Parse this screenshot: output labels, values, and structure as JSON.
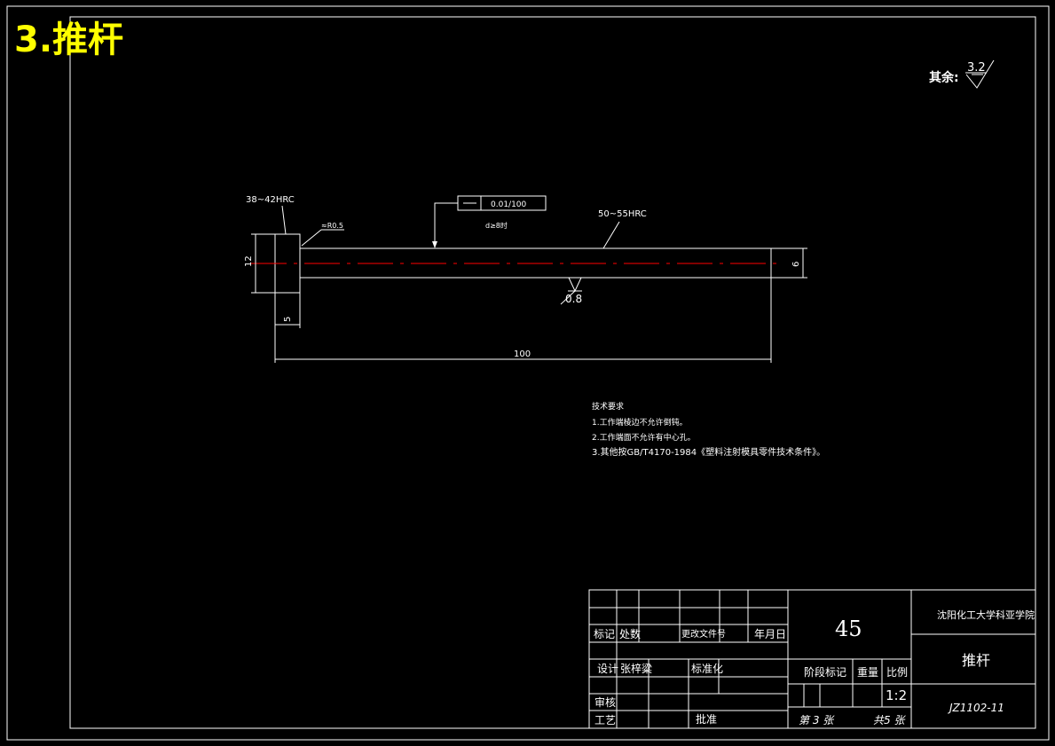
{
  "heading": "3.推杆",
  "roughness_other": {
    "label": "其余:",
    "value": "3.2"
  },
  "hardness_head": "38~42HRC",
  "hardness_rod": "50~55HRC",
  "chamfer": "≈R0.5",
  "tolerance_frame": {
    "value": "0.01/100",
    "note": "d≥8时"
  },
  "surface_finish_rod": "0.8",
  "dimensions": {
    "head_height": "12",
    "head_width": "5",
    "rod_diameter": "6",
    "length": "100"
  },
  "tech_requirements": {
    "title": "技术要求",
    "items": [
      "1.工作端棱边不允许倒钝。",
      "2.工作端面不允许有中心孔。",
      "3.其他按GB/T4170-1984《塑料注射模具零件技术条件》。"
    ]
  },
  "title_block": {
    "header_labels": {
      "mark": "标记",
      "count": "处数",
      "doc_no": "更改文件号",
      "date": "年月日"
    },
    "design_label": "设计",
    "designer": "张梓粱",
    "standard_label": "标准化",
    "review_label": "审核",
    "process_label": "工艺",
    "approve_label": "批准",
    "material": "45",
    "stage_label": "阶段标记",
    "weight_label": "重量",
    "scale_label": "比例",
    "scale": "1:2",
    "sheet": "第 3 张",
    "total": "共5 张",
    "school": "沈阳化工大学科亚学院",
    "part_name": "推杆",
    "drawing_no": "JZ1102-11"
  },
  "colors": {
    "heading": "#ffff00",
    "centerline": "#ff0000",
    "lines": "#ffffff",
    "background": "#000000"
  }
}
